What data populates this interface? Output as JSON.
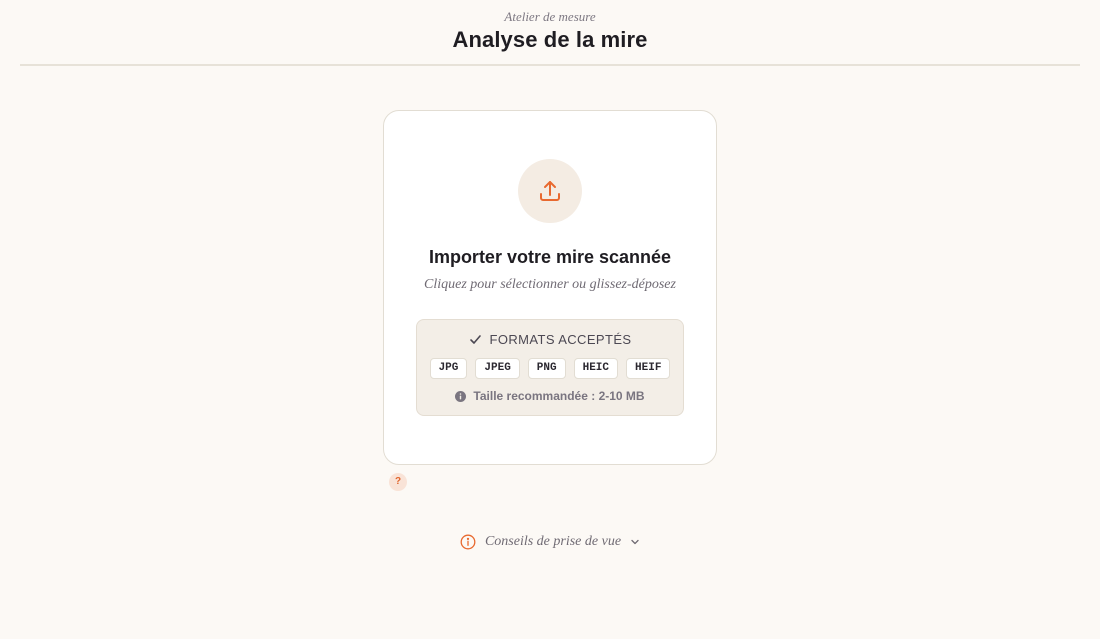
{
  "header": {
    "eyebrow": "Atelier de mesure",
    "title": "Analyse de la mire"
  },
  "upload": {
    "icon": "upload-icon",
    "title": "Importer votre mire scannée",
    "subtitle": "Cliquez pour sélectionner ou glissez-déposez",
    "formats": {
      "heading": "FORMATS ACCEPTÉS",
      "check_icon": "check-icon",
      "list": [
        "JPG",
        "JPEG",
        "PNG",
        "HEIC",
        "HEIF"
      ],
      "info_icon": "info-icon",
      "size_note": "Taille recommandée : 2-10 MB"
    }
  },
  "help": {
    "label": "?"
  },
  "tips": {
    "icon": "info-circle-icon",
    "label": "Conseils de prise de vue",
    "chevron": "chevron-down-icon"
  },
  "colors": {
    "background": "#fcf9f5",
    "accent": "#e8692f",
    "card": "#ffffff",
    "formats_panel": "#f3eee7"
  }
}
